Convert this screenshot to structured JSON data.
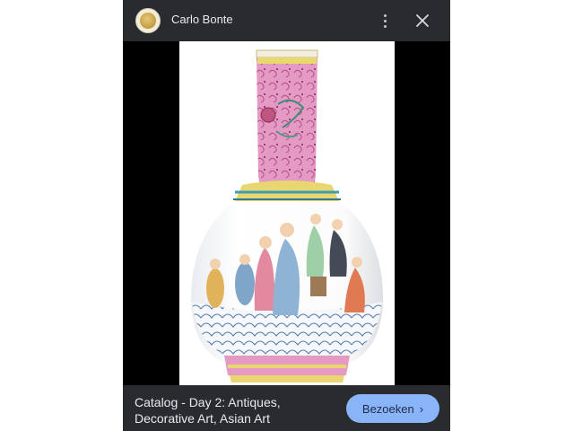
{
  "header": {
    "site_name": "Carlo Bonte",
    "avatar_icon": "auction-house-logo",
    "more_icon": "more-vert-icon",
    "close_icon": "close-icon"
  },
  "image": {
    "subject": "Chinese famille rose bottle vase with the Eight Immortals crossing the sea",
    "background": "#ffffff"
  },
  "footer": {
    "caption": "Catalog - Day 2: Antiques, Decorative Art, Asian Art",
    "visit_label": "Bezoeken",
    "visit_icon": "chevron-right-icon",
    "visit_color": "#8ab4f8"
  },
  "colors": {
    "panel_bg": "#000000",
    "bar_bg": "#2a2b2e",
    "text": "#e8eaed"
  }
}
